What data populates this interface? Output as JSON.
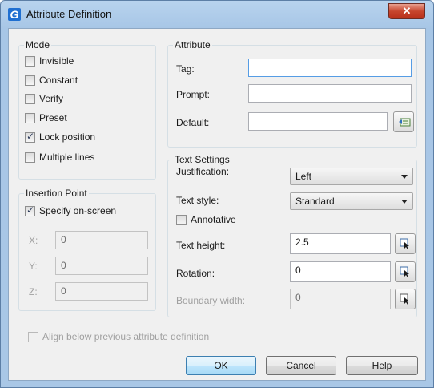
{
  "window": {
    "title": "Attribute Definition",
    "close_glyph": "✕"
  },
  "mode": {
    "title": "Mode",
    "items": [
      {
        "label": "Invisible",
        "checked": false
      },
      {
        "label": "Constant",
        "checked": false
      },
      {
        "label": "Verify",
        "checked": false
      },
      {
        "label": "Preset",
        "checked": false
      },
      {
        "label": "Lock position",
        "checked": true
      },
      {
        "label": "Multiple lines",
        "checked": false
      }
    ]
  },
  "insertion": {
    "title": "Insertion Point",
    "specify_label": "Specify on-screen",
    "specify_checked": true,
    "x_label": "X:",
    "x_value": "0",
    "y_label": "Y:",
    "y_value": "0",
    "z_label": "Z:",
    "z_value": "0"
  },
  "attribute": {
    "title": "Attribute",
    "tag_label": "Tag:",
    "tag_value": "",
    "prompt_label": "Prompt:",
    "prompt_value": "",
    "default_label": "Default:",
    "default_value": "",
    "insert_field_icon": "insert-field-icon"
  },
  "text_settings": {
    "title": "Text Settings",
    "justification_label": "Justification:",
    "justification_value": "Left",
    "style_label": "Text style:",
    "style_value": "Standard",
    "annotative_label": "Annotative",
    "annotative_checked": false,
    "height_label": "Text height:",
    "height_value": "2.5",
    "rotation_label": "Rotation:",
    "rotation_value": "0",
    "boundary_label": "Boundary width:",
    "boundary_value": "0"
  },
  "align_below_label": "Align below previous attribute definition",
  "buttons": {
    "ok": "OK",
    "cancel": "Cancel",
    "help": "Help"
  }
}
